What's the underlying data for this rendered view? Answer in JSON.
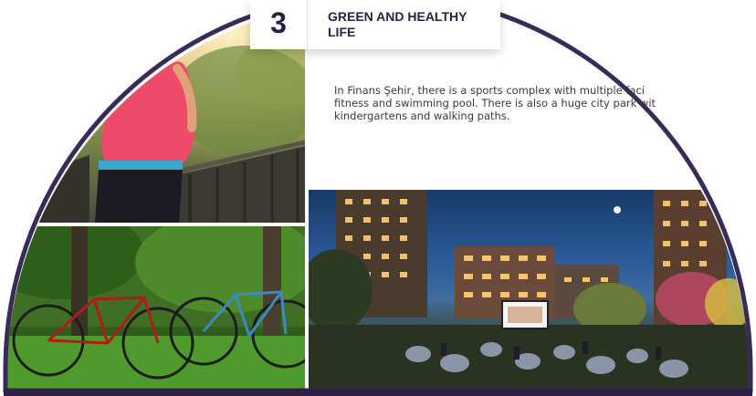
{
  "step": {
    "number": "3",
    "title": "GREEN AND HEALTHY\nLIFE"
  },
  "description": "In Finans Şehir, there is a sports complex with multiple faci\nfitness and swimming pool. There is also a huge city park wit\nkindergartens and walking paths.",
  "photos": {
    "runner": "photo-jogger-on-bridge",
    "bikes": "photo-bicycles-on-grass",
    "night": "photo-outdoor-cinema-night"
  },
  "colors": {
    "accent": "#2a1f44",
    "frame": "#3a2a5a"
  }
}
